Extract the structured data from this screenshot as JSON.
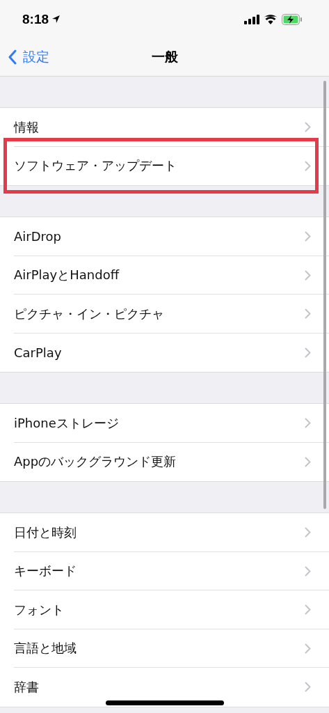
{
  "status_bar": {
    "time": "8:18"
  },
  "nav": {
    "back_label": "設定",
    "title": "一般"
  },
  "groups": [
    {
      "items": [
        {
          "label": "情報",
          "highlighted": false
        },
        {
          "label": "ソフトウェア・アップデート",
          "highlighted": true
        }
      ]
    },
    {
      "items": [
        {
          "label": "AirDrop",
          "highlighted": false
        },
        {
          "label": "AirPlayとHandoff",
          "highlighted": false
        },
        {
          "label": "ピクチャ・イン・ピクチャ",
          "highlighted": false
        },
        {
          "label": "CarPlay",
          "highlighted": false
        }
      ]
    },
    {
      "items": [
        {
          "label": "iPhoneストレージ",
          "highlighted": false
        },
        {
          "label": "Appのバックグラウンド更新",
          "highlighted": false
        }
      ]
    },
    {
      "items": [
        {
          "label": "日付と時刻",
          "highlighted": false
        },
        {
          "label": "キーボード",
          "highlighted": false
        },
        {
          "label": "フォント",
          "highlighted": false
        },
        {
          "label": "言語と地域",
          "highlighted": false
        },
        {
          "label": "辞書",
          "highlighted": false
        }
      ]
    }
  ]
}
